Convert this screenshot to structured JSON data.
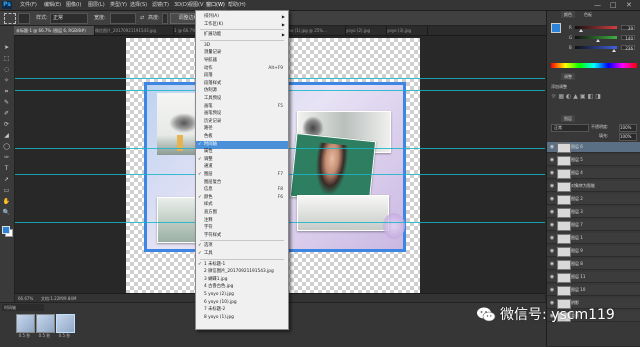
{
  "app": {
    "logo": "Ps"
  },
  "menubar": {
    "items": [
      "文件(F)",
      "编辑(E)",
      "图像(I)",
      "图层(L)",
      "类型(Y)",
      "选择(S)",
      "滤镜(T)",
      "3D(D)",
      "视图(V)",
      "窗口(W)",
      "帮助(H)"
    ],
    "window_controls": [
      "—",
      "□",
      "✕"
    ]
  },
  "options": {
    "mode_label": "样式:",
    "mode_value": "正常",
    "width_label": "宽度:",
    "height_label": "高度:",
    "refine_button": "调整边缘..."
  },
  "tabs": [
    "未标题-1 @ 66.7% (图层 6, RGB/8#)",
    "微信图片_20170921191543.jpg",
    "1 @ 66.7% (...)",
    "2.jpg",
    "yoyo (1).jpg",
    "mx (1).jpg @ 25%...",
    "yoyo (2).jpg",
    "yoyo (3).jpg"
  ],
  "window_menu": {
    "items": [
      {
        "label": "排列(A)",
        "submenu": true
      },
      {
        "label": "工作区(K)",
        "submenu": true
      },
      {
        "sep": true
      },
      {
        "label": "扩展功能",
        "submenu": true
      },
      {
        "sep": true
      },
      {
        "label": "3D"
      },
      {
        "label": "测量记录"
      },
      {
        "label": "导航器"
      },
      {
        "label": "动作",
        "shortcut": "Alt+F9"
      },
      {
        "label": "段落"
      },
      {
        "label": "段落样式"
      },
      {
        "label": "仿制源"
      },
      {
        "label": "工具预设"
      },
      {
        "label": "画笔",
        "shortcut": "F5"
      },
      {
        "label": "画笔预设"
      },
      {
        "label": "历史记录"
      },
      {
        "label": "路径"
      },
      {
        "label": "色板"
      },
      {
        "label": "时间轴",
        "checked": true,
        "highlighted": true
      },
      {
        "label": "属性"
      },
      {
        "label": "调整",
        "checked": true
      },
      {
        "label": "通道"
      },
      {
        "label": "图层",
        "checked": true,
        "shortcut": "F7"
      },
      {
        "label": "图层复合"
      },
      {
        "label": "信息",
        "shortcut": "F8"
      },
      {
        "label": "颜色",
        "checked": true,
        "shortcut": "F6"
      },
      {
        "label": "样式"
      },
      {
        "label": "直方图"
      },
      {
        "label": "注释"
      },
      {
        "label": "字符"
      },
      {
        "label": "字符样式"
      },
      {
        "sep": true
      },
      {
        "label": "选项",
        "checked": true
      },
      {
        "label": "工具",
        "checked": true
      },
      {
        "sep": true
      },
      {
        "label": "1 未标题-1",
        "checked": true
      },
      {
        "label": "2 微信图片_20170921191543.jpg"
      },
      {
        "label": "3 蝴蝶1.jpg"
      },
      {
        "label": "4 古香古色.jpg"
      },
      {
        "label": "5 yoyo (2).jpg"
      },
      {
        "label": "6 yoyo (10).jpg"
      },
      {
        "label": "7 未标题-2"
      },
      {
        "label": "8 yoyo (1).jpg"
      }
    ]
  },
  "statusbar": {
    "zoom": "66.67%",
    "doc": "文档:1.22M/9.84M"
  },
  "filmstrip": {
    "frames": [
      {
        "label": "0.5 秒"
      },
      {
        "label": "0.5 秒"
      },
      {
        "label": "0.5 秒"
      }
    ]
  },
  "right_panel": {
    "color_tab": "颜色",
    "swatch_tab": "色板",
    "sliders": [
      {
        "label": "R",
        "value": "39",
        "color": "#d24040",
        "level": 0.15
      },
      {
        "label": "G",
        "value": "140",
        "color": "#40b040",
        "level": 0.55
      },
      {
        "label": "B",
        "value": "236",
        "color": "#4060e0",
        "level": 0.93
      }
    ],
    "adjust_tab": "调整",
    "adjust_sub": "添加调整",
    "layers_tab": "图层",
    "blend_mode": "正常",
    "opacity_label": "不透明度:",
    "opacity_value": "100%",
    "fill_label": "填充:",
    "fill_value": "100%",
    "layers": [
      {
        "name": "图层 6",
        "selected": true
      },
      {
        "name": "图层 5"
      },
      {
        "name": "图层 4"
      },
      {
        "name": "对象转为智能"
      },
      {
        "name": "图层 2"
      },
      {
        "name": "图层 3"
      },
      {
        "name": "图层 7"
      },
      {
        "name": "图层 1"
      },
      {
        "name": "图层 9"
      },
      {
        "name": "图层 8"
      },
      {
        "name": "图层 11"
      },
      {
        "name": "图层 10"
      },
      {
        "name": "阴影"
      },
      {
        "name": "背景"
      }
    ]
  },
  "watermark": {
    "text": "微信号: yscm119"
  }
}
